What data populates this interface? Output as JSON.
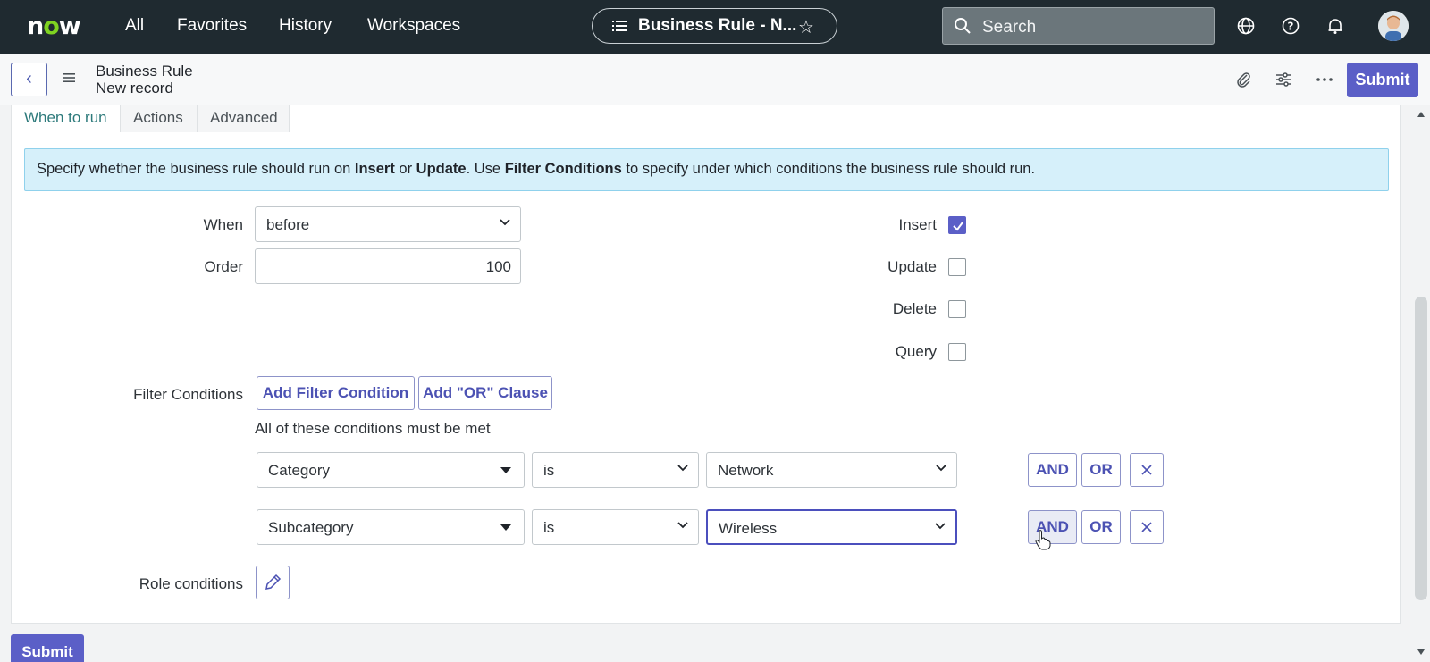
{
  "nav": {
    "logo": "now",
    "links": [
      "All",
      "Favorites",
      "History",
      "Workspaces"
    ],
    "record_pill": "Business Rule - N...",
    "search_placeholder": "Search"
  },
  "header": {
    "title": "Business Rule",
    "subtitle": "New record",
    "submit_label": "Submit"
  },
  "tabs": [
    {
      "label": "When to run",
      "active": true
    },
    {
      "label": "Actions",
      "active": false
    },
    {
      "label": "Advanced",
      "active": false
    }
  ],
  "info": {
    "part1": "Specify whether the business rule should run on ",
    "insert": "Insert",
    "or": " or ",
    "update": "Update",
    "part2": ". Use ",
    "filter": "Filter Conditions",
    "part3": " to specify under which conditions the business rule should run."
  },
  "form": {
    "when_label": "When",
    "when_value": "before",
    "order_label": "Order",
    "order_value": "100",
    "insert_label": "Insert",
    "insert_checked": true,
    "update_label": "Update",
    "update_checked": false,
    "delete_label": "Delete",
    "delete_checked": false,
    "query_label": "Query",
    "query_checked": false,
    "filter_label": "Filter Conditions",
    "add_filter_label": "Add Filter Condition",
    "add_or_label": "Add \"OR\" Clause",
    "conditions_note": "All of these conditions must be met",
    "conditions": [
      {
        "field": "Category",
        "operator": "is",
        "value": "Network"
      },
      {
        "field": "Subcategory",
        "operator": "is",
        "value": "Wireless"
      }
    ],
    "and_label": "AND",
    "or_label": "OR",
    "role_label": "Role conditions"
  },
  "footer": {
    "submit_label": "Submit"
  },
  "colors": {
    "accent": "#5b5fc7",
    "nav_bg": "#1f2a30",
    "info_bg": "#d6f0fa",
    "active_tab": "#2d7a7b"
  }
}
